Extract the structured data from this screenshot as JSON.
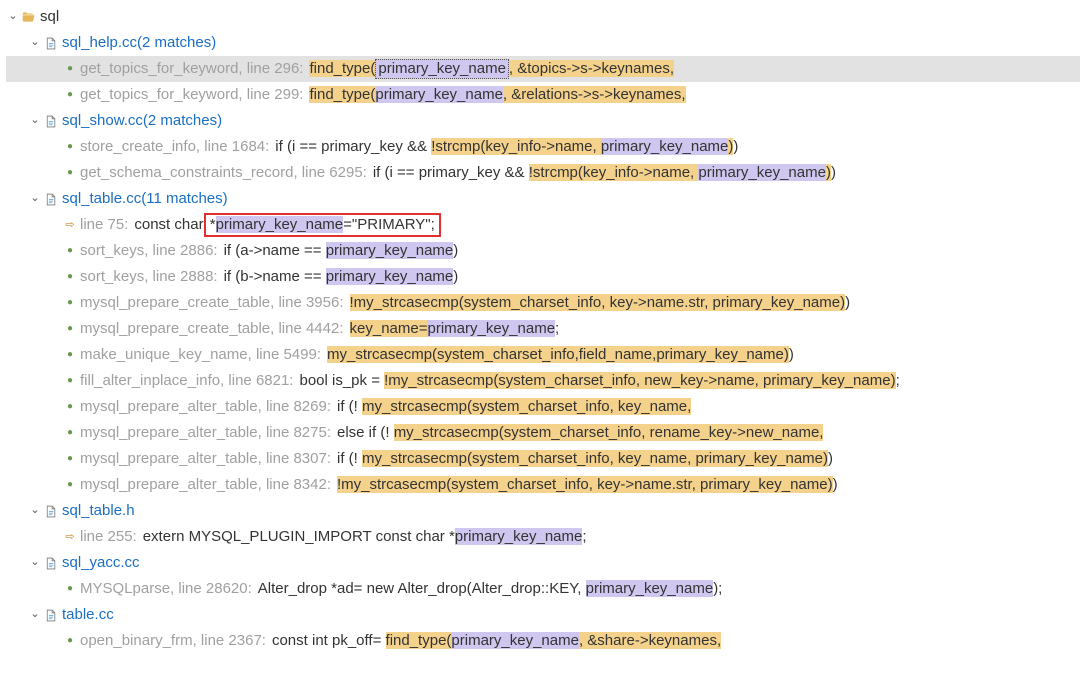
{
  "root": {
    "name": "sql"
  },
  "files": [
    {
      "name": "sql_help.cc",
      "matchText": "(2 matches)",
      "items": [
        {
          "kind": "sel",
          "loc": "get_topics_for_keyword, line 296:",
          "segs": [
            {
              "t": "find_type(",
              "c": "hl-orange"
            },
            {
              "t": "primary_key_name",
              "c": "dottedbox hl-purple"
            },
            {
              "t": ", &topics->s->keynames,",
              "c": "hl-orange"
            }
          ]
        },
        {
          "kind": "dot",
          "loc": "get_topics_for_keyword, line 299:",
          "segs": [
            {
              "t": "find_type(",
              "c": "hl-orange"
            },
            {
              "t": "primary_key_name",
              "c": "hl-purple"
            },
            {
              "t": ", &relations->s->keynames,",
              "c": "hl-orange"
            }
          ]
        }
      ]
    },
    {
      "name": "sql_show.cc",
      "matchText": "(2 matches)",
      "items": [
        {
          "kind": "dot",
          "loc": "store_create_info, line 1684:",
          "segs": [
            {
              "t": "if (i == primary_key && "
            },
            {
              "t": "!strcmp(key_info->name, ",
              "c": "hl-orange"
            },
            {
              "t": "primary_key_name",
              "c": "hl-purple"
            },
            {
              "t": ")",
              "c": "hl-orange"
            },
            {
              "t": ")"
            }
          ]
        },
        {
          "kind": "dot",
          "loc": "get_schema_constraints_record, line 6295:",
          "segs": [
            {
              "t": "if (i == primary_key && "
            },
            {
              "t": "!strcmp(key_info->name, ",
              "c": "hl-orange"
            },
            {
              "t": "primary_key_name",
              "c": "hl-purple"
            },
            {
              "t": ")",
              "c": "hl-orange"
            },
            {
              "t": ")"
            }
          ]
        }
      ]
    },
    {
      "name": "sql_table.cc",
      "matchText": "(11 matches)",
      "items": [
        {
          "kind": "arrow",
          "loc": "line 75:",
          "segs": [
            {
              "t": "const char "
            },
            {
              "t": "*primary_key_name=\"PRIMARY\";",
              "c": "redbox"
            }
          ],
          "purpleInside": "primary_key_name"
        },
        {
          "kind": "dot",
          "loc": "sort_keys, line 2886:",
          "segs": [
            {
              "t": "if (a->name == "
            },
            {
              "t": "primary_key_name",
              "c": "hl-purple"
            },
            {
              "t": ")"
            }
          ]
        },
        {
          "kind": "dot",
          "loc": "sort_keys, line 2888:",
          "segs": [
            {
              "t": "if (b->name == "
            },
            {
              "t": "primary_key_name",
              "c": "hl-purple"
            },
            {
              "t": ")"
            }
          ]
        },
        {
          "kind": "dot",
          "loc": "mysql_prepare_create_table, line 3956:",
          "segs": [
            {
              "t": "!my_strcasecmp(system_charset_info, key->name.str, primary_key_name)",
              "c": "hl-orange"
            },
            {
              "t": ")"
            }
          ]
        },
        {
          "kind": "dot",
          "loc": "mysql_prepare_create_table, line 4442:",
          "segs": [
            {
              "t": "key_name=",
              "c": "hl-orange"
            },
            {
              "t": "primary_key_name",
              "c": "hl-purple"
            },
            {
              "t": ";"
            }
          ]
        },
        {
          "kind": "dot",
          "loc": "make_unique_key_name, line 5499:",
          "segs": [
            {
              "t": "my_strcasecmp(system_charset_info,field_name,primary_key_name)",
              "c": "hl-orange"
            },
            {
              "t": ")"
            }
          ]
        },
        {
          "kind": "dot",
          "loc": "fill_alter_inplace_info, line 6821:",
          "segs": [
            {
              "t": "bool is_pk = "
            },
            {
              "t": "!my_strcasecmp(system_charset_info, new_key->name, primary_key_name)",
              "c": "hl-orange"
            },
            {
              "t": ";"
            }
          ]
        },
        {
          "kind": "dot",
          "loc": "mysql_prepare_alter_table, line 8269:",
          "segs": [
            {
              "t": "if (! "
            },
            {
              "t": "my_strcasecmp(system_charset_info, key_name,",
              "c": "hl-orange"
            }
          ]
        },
        {
          "kind": "dot",
          "loc": "mysql_prepare_alter_table, line 8275:",
          "segs": [
            {
              "t": "else if (! "
            },
            {
              "t": "my_strcasecmp(system_charset_info, rename_key->new_name,",
              "c": "hl-orange"
            }
          ]
        },
        {
          "kind": "dot",
          "loc": "mysql_prepare_alter_table, line 8307:",
          "segs": [
            {
              "t": "if (! "
            },
            {
              "t": "my_strcasecmp(system_charset_info, key_name, primary_key_name)",
              "c": "hl-orange"
            },
            {
              "t": ")"
            }
          ]
        },
        {
          "kind": "dot",
          "loc": "mysql_prepare_alter_table, line 8342:",
          "segs": [
            {
              "t": "!my_strcasecmp(system_charset_info, key->name.str, primary_key_name)",
              "c": "hl-orange"
            },
            {
              "t": ")"
            }
          ]
        }
      ]
    },
    {
      "name": "sql_table.h",
      "matchText": "",
      "items": [
        {
          "kind": "arrow",
          "loc": "line 255:",
          "segs": [
            {
              "t": "extern MYSQL_PLUGIN_IMPORT const char *",
              "c": ""
            },
            {
              "t": "primary_key_name",
              "c": "hl-purple"
            },
            {
              "t": ";"
            }
          ]
        }
      ]
    },
    {
      "name": "sql_yacc.cc",
      "matchText": "",
      "items": [
        {
          "kind": "dot",
          "loc": "MYSQLparse, line 28620:",
          "segs": [
            {
              "t": "Alter_drop *ad= new Alter_drop(Alter_drop::KEY, "
            },
            {
              "t": "primary_key_name",
              "c": "hl-purple"
            },
            {
              "t": ");"
            }
          ]
        }
      ]
    },
    {
      "name": "table.cc",
      "matchText": "",
      "items": [
        {
          "kind": "dot",
          "loc": "open_binary_frm, line 2367:",
          "segs": [
            {
              "t": "const int pk_off= "
            },
            {
              "t": "find_type(",
              "c": "hl-orange"
            },
            {
              "t": "primary_key_name",
              "c": "hl-purple"
            },
            {
              "t": ", &share->keynames,",
              "c": "hl-orange"
            }
          ]
        }
      ]
    }
  ]
}
